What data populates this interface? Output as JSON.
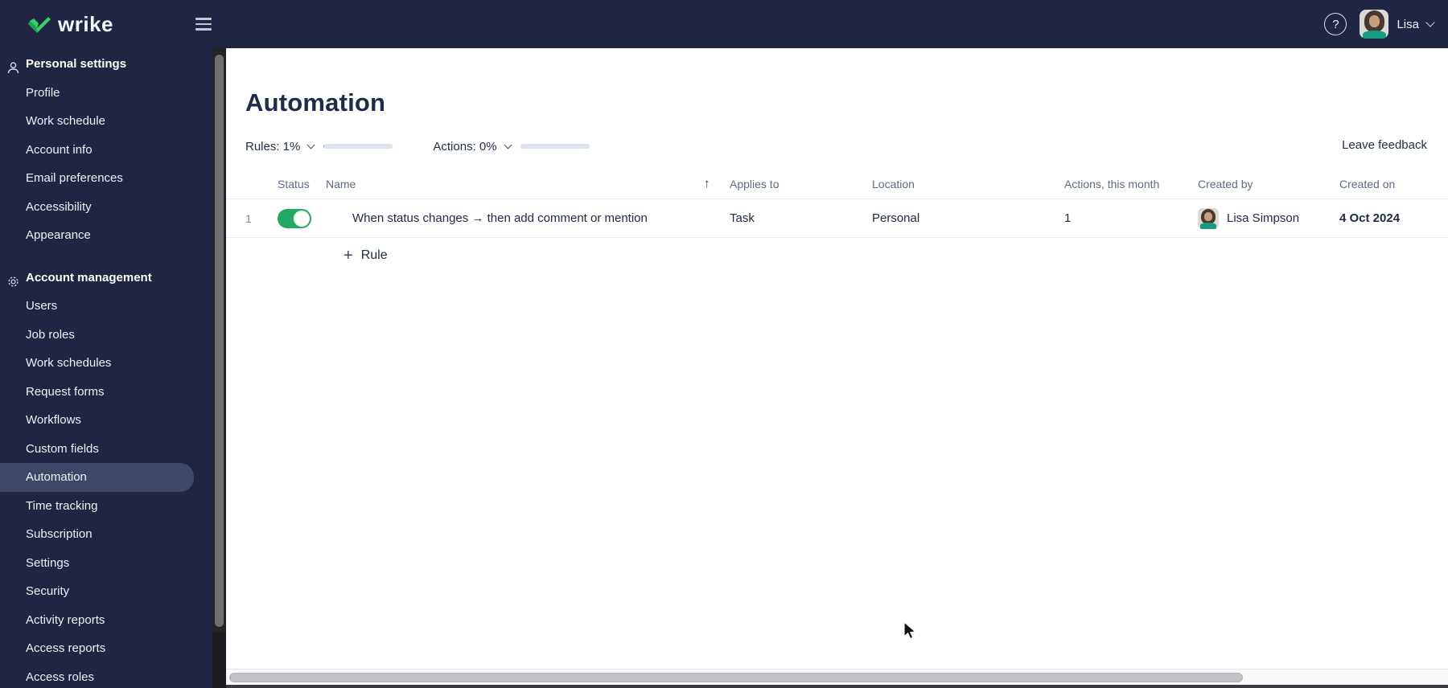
{
  "topbar": {
    "brand": "wrike",
    "help_label": "?",
    "user_name": "Lisa"
  },
  "sidebar": {
    "selected": "Automation",
    "sections": [
      {
        "label": "Personal settings",
        "icon": "person-icon",
        "items": [
          "Profile",
          "Work schedule",
          "Account info",
          "Email preferences",
          "Accessibility",
          "Appearance"
        ]
      },
      {
        "label": "Account management",
        "icon": "gear-icon",
        "items": [
          "Users",
          "Job roles",
          "Work schedules",
          "Request forms",
          "Workflows",
          "Custom fields",
          "Automation",
          "Time tracking",
          "Subscription",
          "Settings",
          "Security",
          "Activity reports",
          "Access reports",
          "Access roles"
        ]
      }
    ]
  },
  "main": {
    "title": "Automation",
    "stats": [
      {
        "label": "Rules: 1%",
        "percent": 1
      },
      {
        "label": "Actions: 0%",
        "percent": 0
      }
    ],
    "feedback_link": "Leave feedback",
    "add_rule_plus": "+",
    "add_rule_label": "Rule",
    "table": {
      "columns": [
        "Status",
        "Name",
        "Applies to",
        "Location",
        "Actions, this month",
        "Created by",
        "Created on"
      ],
      "sorted_column": "Name",
      "sort_icon": "↑",
      "rows": [
        {
          "index": "1",
          "status_on": true,
          "name": "When status changes → then add comment or mention",
          "applies_to": "Task",
          "location": "Personal",
          "actions_this_month": "1",
          "created_by": "Lisa Simpson",
          "created_on": "4 Oct 2024"
        }
      ]
    }
  },
  "colors": {
    "topbar_bg": "#1f2543",
    "selected_item_bg": "#3e4767",
    "brand_green": "#2fc25b",
    "toggle_on": "#23a964",
    "progress_track": "#dde3ee"
  }
}
